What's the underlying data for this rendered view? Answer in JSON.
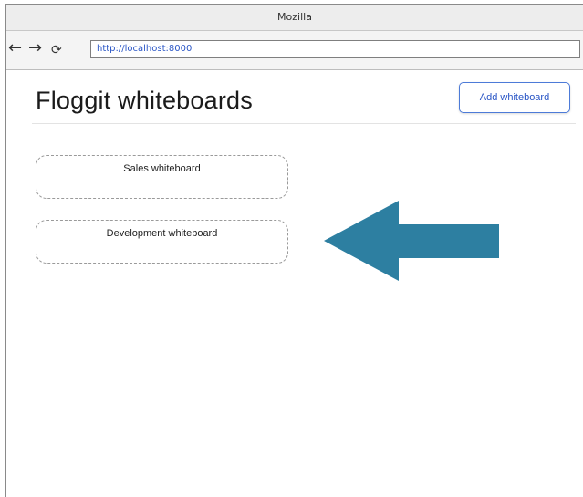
{
  "window": {
    "title": "Mozilla"
  },
  "toolbar": {
    "back_icon": "←",
    "forward_icon": "→",
    "reload_icon": "⟳",
    "url": "http://localhost:8000"
  },
  "page": {
    "title": "Floggit whiteboards",
    "add_button_label": "Add whiteboard",
    "whiteboards": [
      {
        "label": "Sales whiteboard"
      },
      {
        "label": "Development whiteboard"
      }
    ]
  },
  "colors": {
    "arrow": "#2d7fa1",
    "link": "#2a56c6",
    "button_border": "#4d7bd8"
  },
  "icons": [
    "back-arrow-icon",
    "forward-arrow-icon",
    "reload-icon",
    "callout-arrow-icon"
  ]
}
